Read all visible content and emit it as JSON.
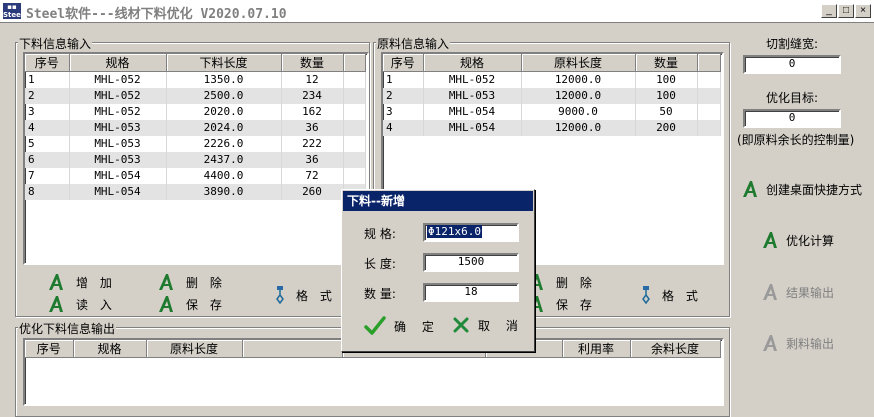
{
  "window": {
    "title": "Steel软件---线材下料优化 V2020.07.10",
    "logo_text": "Steel",
    "minimize": "_",
    "maximize": "□",
    "close": "×"
  },
  "cut_input": {
    "title": "下料信息输入",
    "columns": [
      "序号",
      "规格",
      "下料长度",
      "数量"
    ],
    "rows": [
      [
        "1",
        "MHL-052",
        "1350.0",
        "12"
      ],
      [
        "2",
        "MHL-052",
        "2500.0",
        "234"
      ],
      [
        "3",
        "MHL-052",
        "2020.0",
        "162"
      ],
      [
        "4",
        "MHL-053",
        "2024.0",
        "36"
      ],
      [
        "5",
        "MHL-053",
        "2226.0",
        "222"
      ],
      [
        "6",
        "MHL-053",
        "2437.0",
        "36"
      ],
      [
        "7",
        "MHL-054",
        "4400.0",
        "72"
      ],
      [
        "8",
        "MHL-054",
        "3890.0",
        "260"
      ]
    ],
    "buttons": {
      "add": "增 加",
      "delete": "删 除",
      "read": "读 入",
      "save": "保 存",
      "format": "格 式"
    }
  },
  "raw_input": {
    "title": "原料信息输入",
    "columns": [
      "序号",
      "规格",
      "原料长度",
      "数量"
    ],
    "rows": [
      [
        "1",
        "MHL-052",
        "12000.0",
        "100"
      ],
      [
        "2",
        "MHL-053",
        "12000.0",
        "100"
      ],
      [
        "3",
        "MHL-054",
        "9000.0",
        "50"
      ],
      [
        "4",
        "MHL-054",
        "12000.0",
        "200"
      ]
    ],
    "buttons": {
      "delete": "删 除",
      "save": "保 存",
      "format": "格 式"
    }
  },
  "output": {
    "title": "优化下料信息输出",
    "columns": [
      "序号",
      "规格",
      "原料长度",
      "",
      "",
      "",
      "利用率",
      "余料长度"
    ]
  },
  "side": {
    "kerf_label": "切割缝宽:",
    "kerf_value": "0",
    "target_label": "优化目标:",
    "target_value": "0",
    "target_hint": "(即原料余长的控制量)",
    "shortcut": "创建桌面快捷方式",
    "optimize": "优化计算",
    "result_output": "结果输出",
    "remnant_output": "剩料输出"
  },
  "dialog": {
    "title": "下料--新增",
    "spec_label": "规 格:",
    "spec_value": "Φ121x6.0",
    "length_label": "长 度:",
    "length_value": "1500",
    "qty_label": "数 量:",
    "qty_value": "18",
    "ok": "确 定",
    "cancel": "取 消"
  },
  "colors": {
    "face": "#d4d0c8",
    "dialog_title": "#0a246a",
    "icon_green": "#1e7a2e",
    "ok_green": "#2aa02a",
    "cancel_green": "#1e8a3a",
    "row_alt": "#e3e3e3"
  },
  "icons": {
    "action": "green-a-icon",
    "format": "format-brush-icon",
    "ok": "checkmark-icon",
    "cancel": "x-icon"
  }
}
